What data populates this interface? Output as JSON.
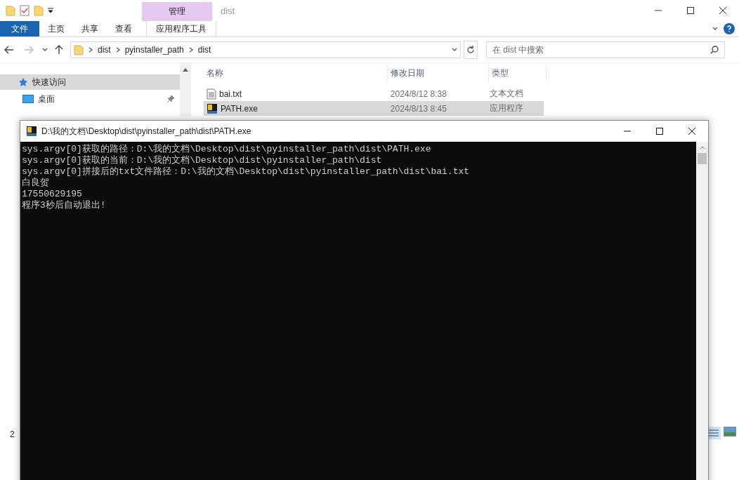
{
  "explorer": {
    "title": "dist",
    "context_tab": "管理",
    "ribbon_tabs": [
      {
        "label": "文件",
        "kind": "file"
      },
      {
        "label": "主页",
        "kind": "tab"
      },
      {
        "label": "共享",
        "kind": "tab"
      },
      {
        "label": "查看",
        "kind": "tab"
      },
      {
        "label": "应用程序工具",
        "kind": "context"
      }
    ],
    "breadcrumb": [
      "dist",
      "pyinstaller_path",
      "dist"
    ],
    "search": {
      "placeholder": "在 dist 中搜索"
    },
    "nav_items": [
      {
        "label": "快速访问",
        "kind": "star",
        "selected": true,
        "pinned": false
      },
      {
        "label": "桌面",
        "kind": "desktop",
        "selected": false,
        "pinned": true
      }
    ],
    "columns": [
      "名称",
      "修改日期",
      "类型"
    ],
    "rows": [
      {
        "name": "bai.txt",
        "modified": "2024/8/12 8:38",
        "type": "文本文档",
        "kind": "text",
        "selected": false
      },
      {
        "name": "PATH.exe",
        "modified": "2024/8/13 8:45",
        "type": "应用程序",
        "kind": "exe",
        "selected": true
      }
    ],
    "status_bar": {
      "count": "2"
    }
  },
  "console": {
    "title": "D:\\我的文档\\Desktop\\dist\\pyinstaller_path\\dist\\PATH.exe",
    "lines": [
      "sys.argv[0]获取的路径：D:\\我的文档\\Desktop\\dist\\pyinstaller_path\\dist\\PATH.exe",
      "sys.argv[0]获取的当前：D:\\我的文档\\Desktop\\dist\\pyinstaller_path\\dist",
      "sys.argv[0]拼接后的txt文件路径：D:\\我的文档\\Desktop\\dist\\pyinstaller_path\\dist\\bai.txt",
      "白良贺",
      "17550629195",
      "程序3秒后自动退出!"
    ]
  }
}
